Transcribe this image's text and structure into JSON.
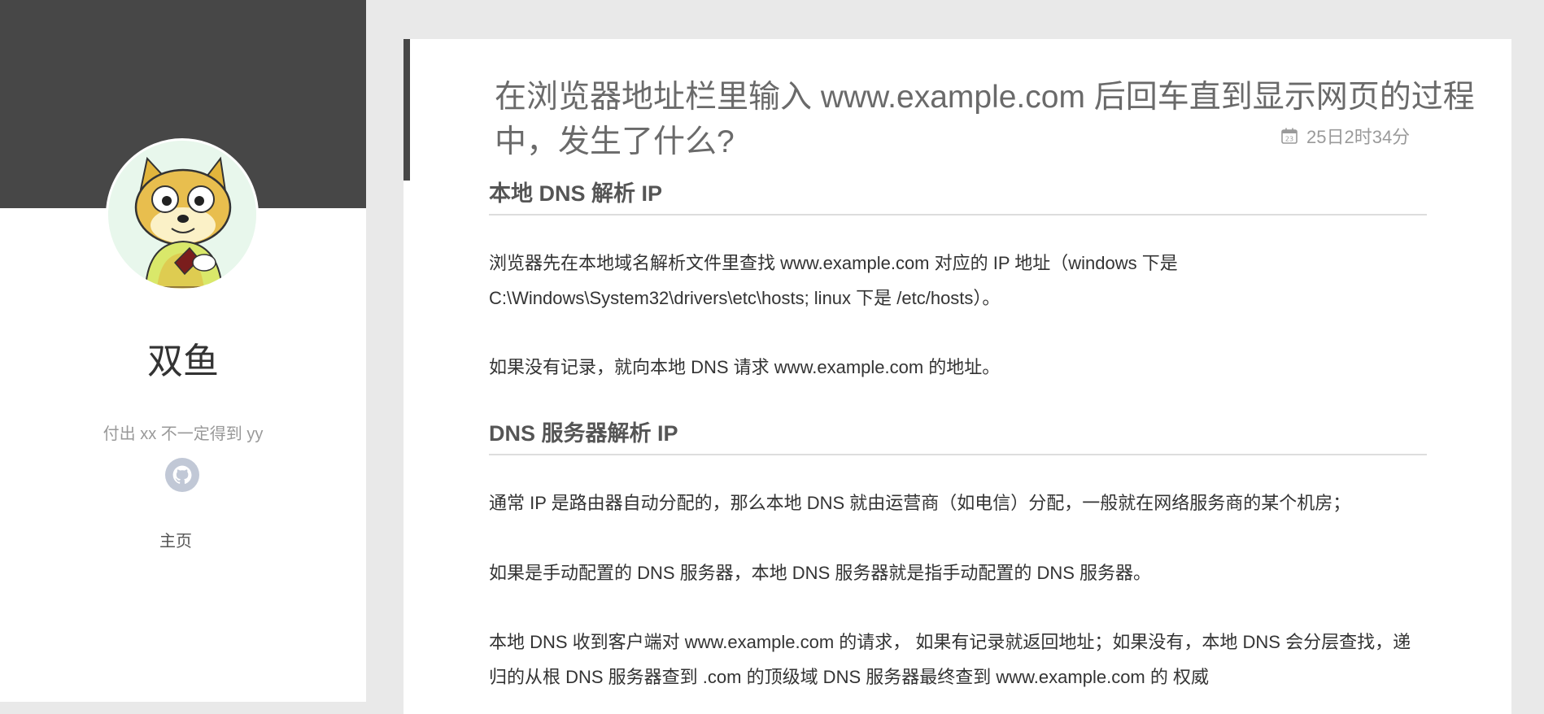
{
  "sidebar": {
    "site_name": "双鱼",
    "description": "付出 xx 不一定得到 yy",
    "home_label": "主页",
    "github_icon": "github-icon",
    "banner_color": "#474747"
  },
  "article": {
    "title": "在浏览器地址栏里输入 www.example.com 后回车直到显示网页的过程中，发生了什么?",
    "date_icon": "calendar-icon",
    "date": "25日2时34分",
    "sections": [
      {
        "heading": "本地 DNS 解析 IP",
        "paragraphs": [
          "浏览器先在本地域名解析文件里查找 www.example.com 对应的 IP 地址（windows 下是 C:\\Windows\\System32\\drivers\\etc\\hosts; linux 下是 /etc/hosts）。",
          "如果没有记录，就向本地 DNS 请求 www.example.com 的地址。"
        ]
      },
      {
        "heading": "DNS 服务器解析 IP",
        "paragraphs": [
          "通常 IP 是路由器自动分配的，那么本地 DNS 就由运营商（如电信）分配，一般就在网络服务商的某个机房；",
          "如果是手动配置的 DNS 服务器，本地 DNS 服务器就是指手动配置的 DNS 服务器。",
          "本地 DNS 收到客户端对 www.example.com 的请求， 如果有记录就返回地址；如果没有，本地 DNS 会分层查找，递归的从根 DNS 服务器查到 .com 的顶级域 DNS 服务器最终查到 www.example.com 的 权威"
        ]
      }
    ]
  }
}
